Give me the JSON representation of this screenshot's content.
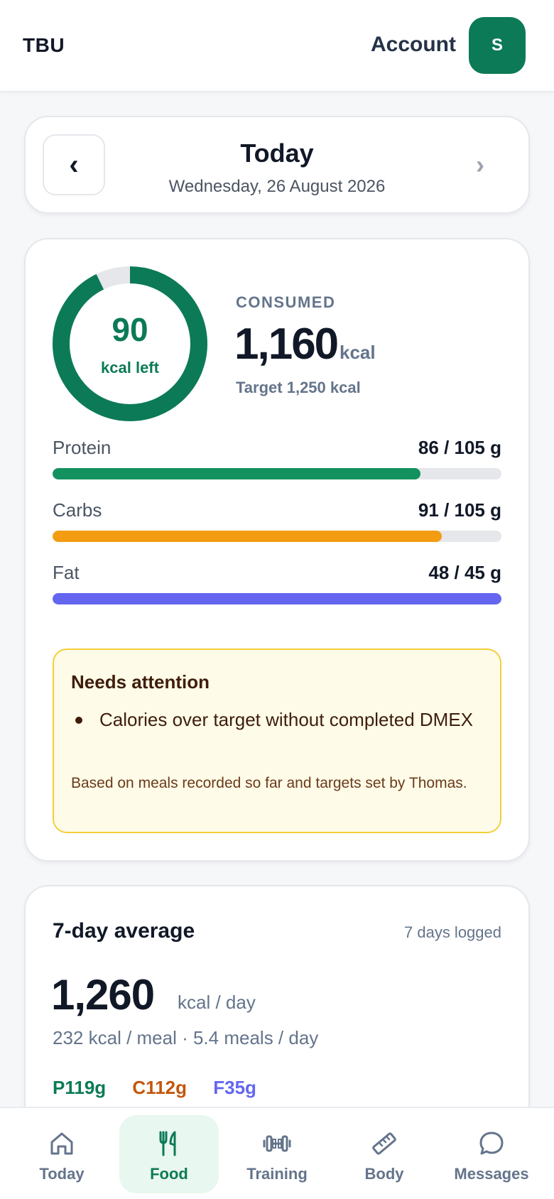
{
  "header": {
    "brand": "TBU",
    "account_label": "Account",
    "avatar_initial": "S"
  },
  "date_nav": {
    "prev_icon": "‹",
    "next_icon": "›",
    "title": "Today",
    "date": "Wednesday, 26 August 2026"
  },
  "summary": {
    "ring": {
      "value": "90",
      "label": "kcal left",
      "consumed_fraction": 0.928
    },
    "consumed_label": "CONSUMED",
    "consumed_value": "1,160",
    "consumed_unit": "kcal",
    "target_text": "Target 1,250 kcal",
    "macros": [
      {
        "name": "Protein",
        "value": "86 / 105 g",
        "fraction": 0.819,
        "color": "#13915f"
      },
      {
        "name": "Carbs",
        "value": "91 / 105 g",
        "fraction": 0.867,
        "color": "#f39c12"
      },
      {
        "name": "Fat",
        "value": "48 / 45 g",
        "fraction": 1.0,
        "color": "#6466f0"
      }
    ],
    "alert": {
      "title": "Needs attention",
      "items": [
        "Calories over target without completed DMEX"
      ],
      "note": "Based on meals recorded so far and targets set by Thomas."
    }
  },
  "weekly": {
    "title": "7-day average",
    "logged": "7 days logged",
    "value": "1,260",
    "unit": "kcal / day",
    "sub": "232 kcal / meal · 5.4 meals / day",
    "protein": "P119g",
    "carbs": "C112g",
    "fat": "F35g",
    "protein_color": "#0c7a57",
    "carbs_color": "#c2570c",
    "fat_color": "#6466f0"
  },
  "bottom_nav": {
    "items": [
      {
        "label": "Today",
        "icon": "home-icon"
      },
      {
        "label": "Food",
        "icon": "fork-knife-icon",
        "active": true
      },
      {
        "label": "Training",
        "icon": "dumbbell-icon"
      },
      {
        "label": "Body",
        "icon": "ruler-icon"
      },
      {
        "label": "Messages",
        "icon": "chat-bubble-icon"
      }
    ]
  },
  "colors": {
    "accent": "#0c7a57",
    "ring_track": "#e5e7eb"
  }
}
